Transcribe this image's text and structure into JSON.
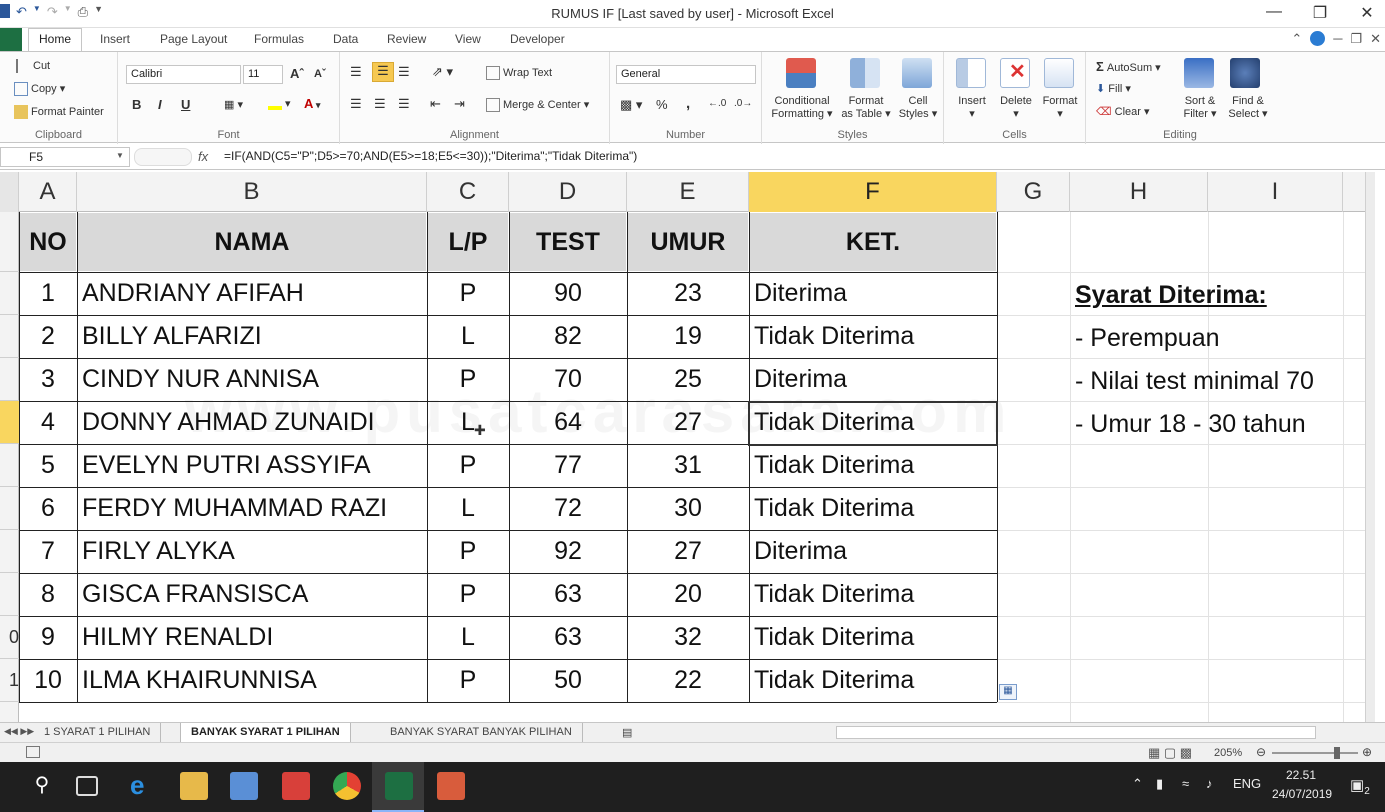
{
  "window": {
    "title": "RUMUS IF [Last saved by user]  -  Microsoft Excel",
    "minimize": "—",
    "restore": "❐",
    "close": "✕"
  },
  "tabs": [
    "Home",
    "Insert",
    "Page Layout",
    "Formulas",
    "Data",
    "Review",
    "View",
    "Developer"
  ],
  "ribbon": {
    "clipboard": {
      "cut": "Cut",
      "copy": "Copy",
      "format_painter": "Format Painter",
      "label": "Clipboard"
    },
    "font": {
      "name": "Calibri",
      "size": "11",
      "bold": "B",
      "italic": "I",
      "underline": "U",
      "label": "Font"
    },
    "alignment": {
      "wrap": "Wrap Text",
      "merge": "Merge & Center",
      "label": "Alignment"
    },
    "number": {
      "format": "General",
      "percent": "%",
      "comma": ",",
      "label": "Number"
    },
    "styles": {
      "conditional": [
        "Conditional",
        "Formatting"
      ],
      "table": [
        "Format",
        "as Table"
      ],
      "cell": [
        "Cell",
        "Styles"
      ],
      "label": "Styles"
    },
    "cells": {
      "insert": "Insert",
      "delete": "Delete",
      "format": "Format",
      "label": "Cells"
    },
    "editing": {
      "autosum": "AutoSum",
      "fill": "Fill",
      "clear": "Clear",
      "sort": [
        "Sort &",
        "Filter"
      ],
      "find": [
        "Find &",
        "Select"
      ],
      "label": "Editing"
    }
  },
  "formula_bar": {
    "name_box": "F5",
    "fx": "fx",
    "formula": "=IF(AND(C5=\"P\";D5>=70;AND(E5>=18;E5<=30));\"Diterima\";\"Tidak Diterima\")"
  },
  "columns": [
    "A",
    "B",
    "C",
    "D",
    "E",
    "F",
    "G",
    "H",
    "I"
  ],
  "row_numbers": [
    "",
    "",
    "",
    "",
    "",
    "",
    "",
    "",
    "0",
    "1"
  ],
  "table": {
    "headers": [
      "NO",
      "NAMA",
      "L/P",
      "TEST",
      "UMUR",
      "KET."
    ],
    "rows": [
      [
        "1",
        "ANDRIANY AFIFAH",
        "P",
        "90",
        "23",
        "Diterima"
      ],
      [
        "2",
        "BILLY ALFARIZI",
        "L",
        "82",
        "19",
        "Tidak Diterima"
      ],
      [
        "3",
        "CINDY NUR ANNISA",
        "P",
        "70",
        "25",
        "Diterima"
      ],
      [
        "4",
        "DONNY AHMAD ZUNAIDI",
        "L",
        "64",
        "27",
        "Tidak Diterima"
      ],
      [
        "5",
        "EVELYN PUTRI ASSYIFA",
        "P",
        "77",
        "31",
        "Tidak Diterima"
      ],
      [
        "6",
        "FERDY MUHAMMAD RAZI",
        "L",
        "72",
        "30",
        "Tidak Diterima"
      ],
      [
        "7",
        "FIRLY ALYKA",
        "P",
        "92",
        "27",
        "Diterima"
      ],
      [
        "8",
        "GISCA FRANSISCA",
        "P",
        "63",
        "20",
        "Tidak Diterima"
      ],
      [
        "9",
        "HILMY RENALDI",
        "L",
        "63",
        "32",
        "Tidak Diterima"
      ],
      [
        "10",
        "ILMA KHAIRUNNISA",
        "P",
        "50",
        "22",
        "Tidak Diterima"
      ]
    ]
  },
  "notes": {
    "title": "Syarat Diterima:",
    "items": [
      "- Perempuan",
      "- Nilai test minimal 70",
      "- Umur 18 - 30 tahun"
    ]
  },
  "watermark": "www.pusatcarasara.com",
  "sheet_tabs": [
    "1 SYARAT 1 PILIHAN",
    "BANYAK SYARAT 1 PILIHAN",
    "BANYAK SYARAT BANYAK PILIHAN"
  ],
  "status": {
    "zoom": "205%"
  },
  "taskbar": {
    "lang": "ENG",
    "time": "22.51",
    "date": "24/07/2019",
    "notifications": "2"
  },
  "colors": {
    "excel_green": "#1d6f42",
    "selected_header": "#f9d65f",
    "table_header": "#d9d9d9"
  }
}
